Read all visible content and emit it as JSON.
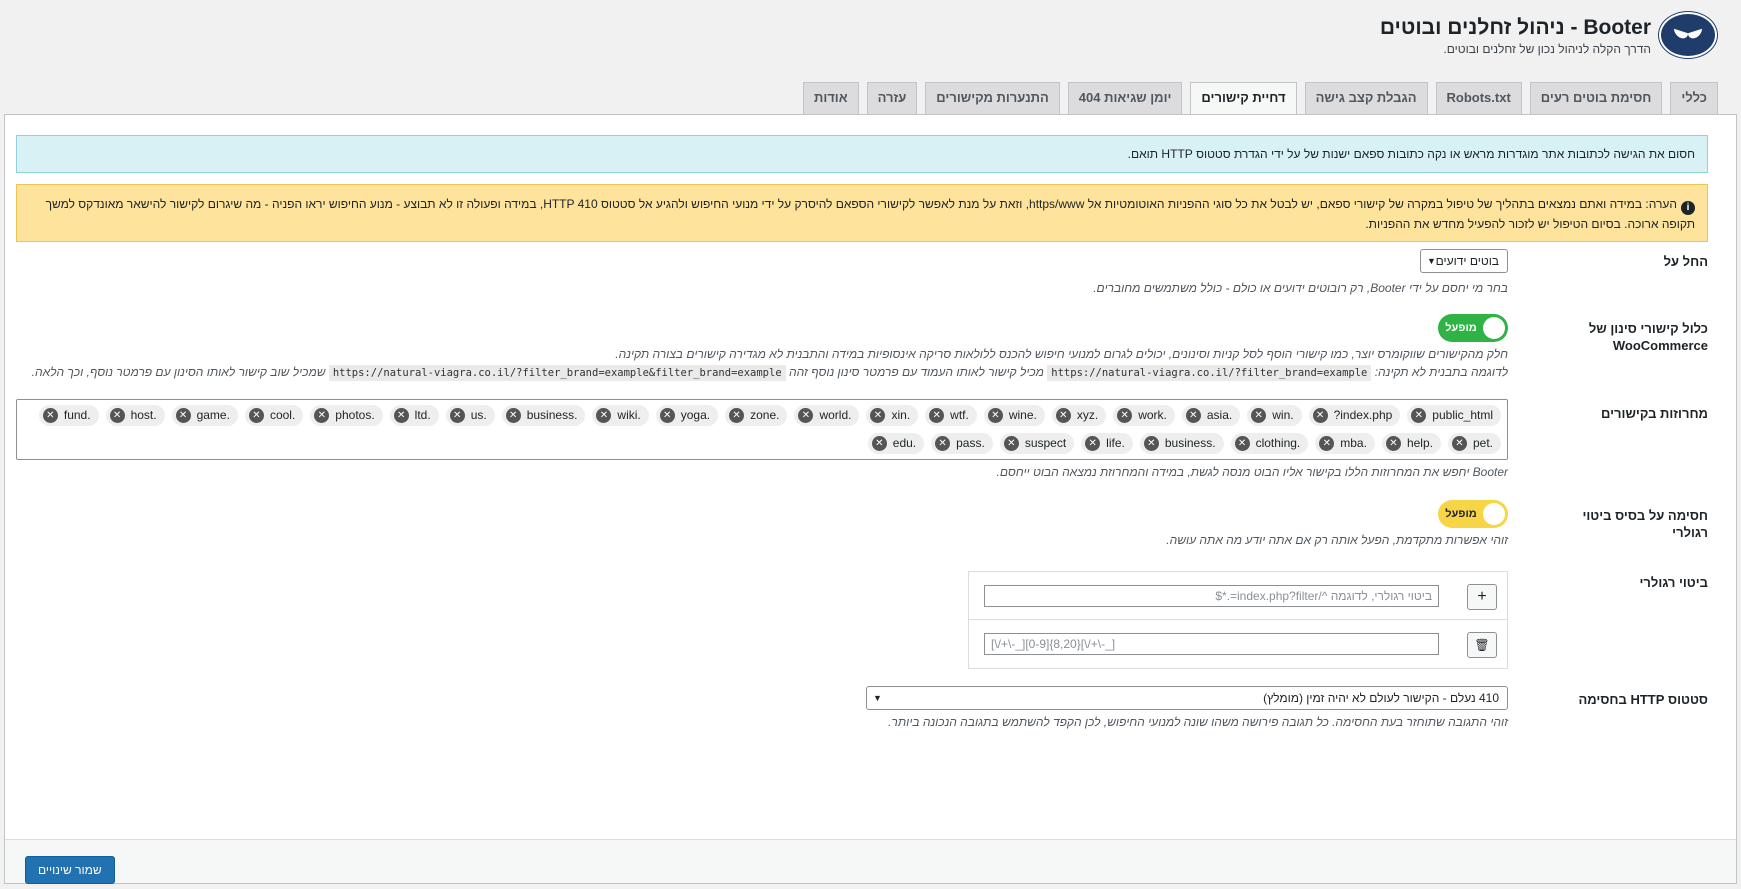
{
  "header": {
    "title": "Booter - ניהול זחלנים ובוטים",
    "subtitle": "הדרך הקלה לניהול נכון של זחלנים ובוטים."
  },
  "tabs": [
    {
      "label": "כללי",
      "active": false
    },
    {
      "label": "חסימת בוטים רעים",
      "active": false
    },
    {
      "label": "Robots.txt",
      "active": false
    },
    {
      "label": "הגבלת קצב גישה",
      "active": false
    },
    {
      "label": "דחיית קישורים",
      "active": true
    },
    {
      "label": "יומן שגיאות 404",
      "active": false
    },
    {
      "label": "התנערות מקישורים",
      "active": false
    },
    {
      "label": "עזרה",
      "active": false
    },
    {
      "label": "אודות",
      "active": false
    }
  ],
  "notices": {
    "info": "חסום את הגישה לכתובות אתר מוגדרות מראש או נקה כתובות ספאם ישנות של על ידי הגדרת סטטוס HTTP תואם.",
    "warning": "הערה: במידה ואתם נמצאים בתהליך של טיפול במקרה של קישורי ספאם, יש לבטל את כל סוגי ההפניות האוטומטיות אל https/www, וזאת על מנת לאפשר לקישורי הספאם להיסרק על ידי מנועי החיפוש ולהגיע אל סטטוס HTTP 410, במידה ופעולה זו לא תבוצע - מנוע החיפוש יראו הפניה - מה שיגרום לקישור להישאר מאונדקס למשך תקופה ארוכה. בסיום הטיפול יש לזכור להפעיל מחדש את ההפניות."
  },
  "fields": {
    "apply_on": {
      "label": "החל על",
      "value": "בוטים ידועים",
      "desc": "בחר מי יחסם על ידי Booter, רק רובוטים ידועים או כולם - כולל משתמשים מחוברים."
    },
    "woocommerce": {
      "label": "כלול קישורי סינון של WooCommerce",
      "toggle": "מופעל",
      "desc1": "חלק מהקישורים שווקומרס יוצר, כמו קישורי הוסף לסל קניות וסינונים, יכולים לגרום למנועי חיפוש להכנס ללולאות סריקה אינסופיות במידה והתבנית לא מגדירה קישורים בצורה תקינה.",
      "desc2_a": "לדוגמה בתבנית לא תקינה:",
      "code1": "https://natural-viagra.co.il/?filter_brand=example",
      "desc2_b": "מכיל קישור לאותו העמוד עם פרמטר סינון נוסף זהה",
      "code2": "https://natural-viagra.co.il/?filter_brand=example&filter_brand=example",
      "desc2_c": "שמכיל שוב קישור לאותו הסינון עם פרמטר נוסף, וכך הלאה."
    },
    "strings": {
      "label": "מחרוזות בקישורים",
      "tags": [
        "public_html",
        "?index.php",
        "win.",
        "asia.",
        "work.",
        "xyz.",
        "wine.",
        "wtf.",
        "xin.",
        "world.",
        "zone.",
        "yoga.",
        "wiki.",
        "business.",
        "us.",
        "ltd.",
        "photos.",
        "cool.",
        "game.",
        "host.",
        "fund.",
        "pet.",
        "help.",
        "mba.",
        "clothing.",
        "business.",
        "life.",
        "suspect",
        "pass.",
        "edu."
      ],
      "desc": "Booter יחפש את המחרוזות הללו בקישור אליו הבוט מנסה לגשת, במידה והמחרוזת נמצאה הבוט ייחסם."
    },
    "regex_block": {
      "label": "חסימה על בסיס ביטוי רגולרי",
      "toggle": "מופעל",
      "desc": "זוהי אפשרות מתקדמת, הפעל אותה רק אם אתה יודע מה אתה עושה."
    },
    "regex": {
      "label": "ביטוי רגולרי",
      "placeholder": "ביטוי רגולרי, לדוגמה ^/index.php?filter=.*$",
      "value": "[\\/+\\-_][0-9]{8,20}[\\/+\\-_]",
      "add_symbol": "+",
      "delete_symbol": "🗑"
    },
    "http_status": {
      "label": "סטטוס HTTP בחסימה",
      "value": "410 נעלם - הקישור לעולם לא יהיה זמין (מומלץ)",
      "desc": "זוהי התגובה שתוחזר בעת החסימה. כל תגובה פירושה משהו שונה למנועי החיפוש, לכן הקפד להשתמש בתגובה הנכונה ביותר."
    }
  },
  "save_label": "שמור שינויים",
  "colors": {
    "accent": "#2271b1",
    "toggle_on": "#2fb344",
    "toggle_warn": "#f7d547"
  }
}
